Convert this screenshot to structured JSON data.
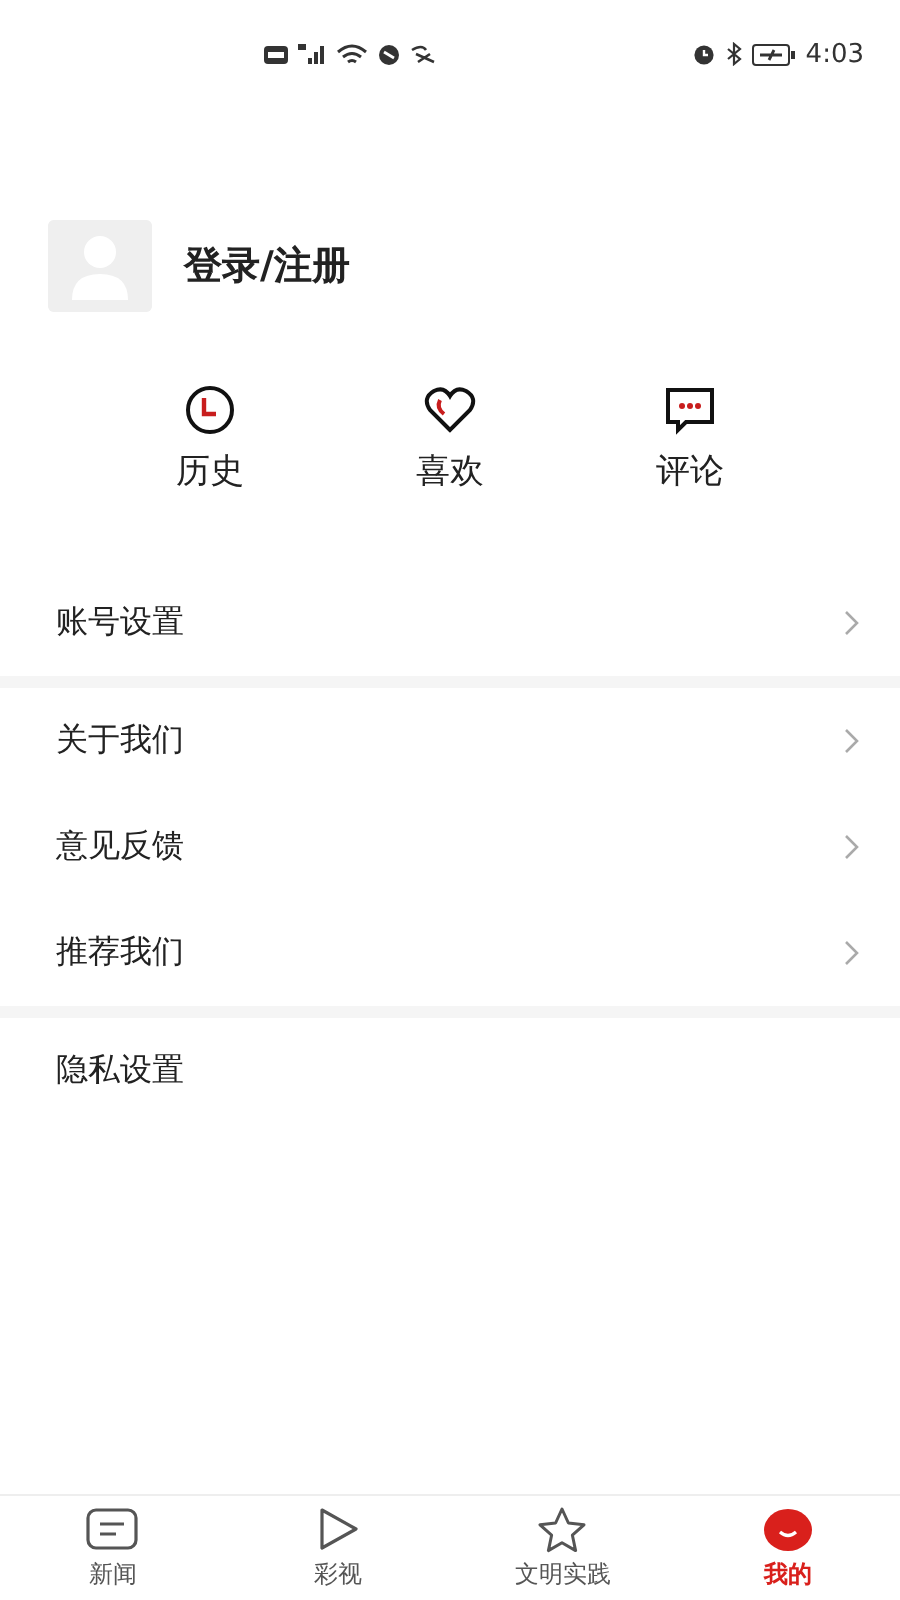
{
  "status_bar": {
    "time": "4:03"
  },
  "profile": {
    "login_label": "登录/注册"
  },
  "shortcuts": [
    {
      "kind": "history",
      "label": "历史"
    },
    {
      "kind": "like",
      "label": "喜欢"
    },
    {
      "kind": "comment",
      "label": "评论"
    }
  ],
  "menu_groups": [
    [
      {
        "label": "账号设置",
        "arrow": true
      }
    ],
    [
      {
        "label": "关于我们",
        "arrow": true
      },
      {
        "label": "意见反馈",
        "arrow": true
      },
      {
        "label": "推荐我们",
        "arrow": true
      }
    ],
    [
      {
        "label": "隐私设置",
        "arrow": false
      }
    ]
  ],
  "tab_bar": [
    {
      "kind": "news",
      "label": "新闻",
      "selected": false
    },
    {
      "kind": "video",
      "label": "彩视",
      "selected": false
    },
    {
      "kind": "star",
      "label": "文明实践",
      "selected": false
    },
    {
      "kind": "me",
      "label": "我的",
      "selected": true
    }
  ]
}
